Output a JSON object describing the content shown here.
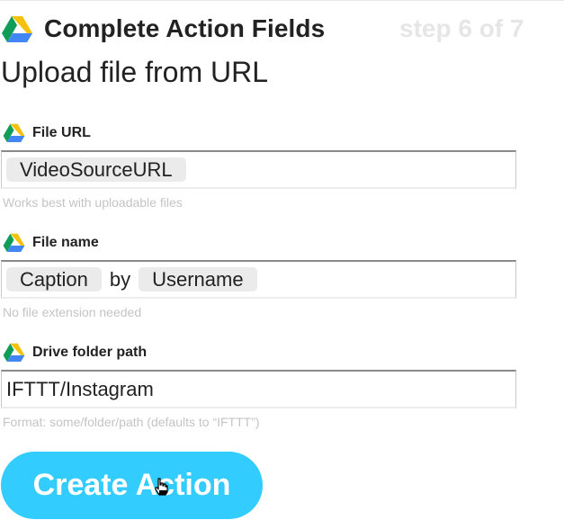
{
  "header": {
    "service_icon": "google-drive-icon",
    "title": "Complete Action Fields",
    "step": "step 6 of 7"
  },
  "action": {
    "title": "Upload file from URL"
  },
  "fields": [
    {
      "icon": "google-drive-icon",
      "label": "File URL",
      "tokens": [
        {
          "type": "ingredient",
          "text": "VideoSourceURL"
        }
      ],
      "help": "Works best with uploadable files"
    },
    {
      "icon": "google-drive-icon",
      "label": "File name",
      "tokens": [
        {
          "type": "ingredient",
          "text": "Caption"
        },
        {
          "type": "text",
          "text": "by"
        },
        {
          "type": "ingredient",
          "text": "Username"
        }
      ],
      "help": "No file extension needed"
    },
    {
      "icon": "google-drive-icon",
      "label": "Drive folder path",
      "tokens": [
        {
          "type": "text",
          "text": "IFTTT/Instagram"
        }
      ],
      "help": "Format: some/folder/path (defaults to “IFTTT”)"
    }
  ],
  "create_button": {
    "label": "Create Action",
    "color": "#33ccff"
  },
  "colors": {
    "drive_green": "#0f9d58",
    "drive_yellow": "#f4c20d",
    "drive_blue": "#4285f4",
    "step_text": "#e6e6e6",
    "help_text": "#c4c4c4"
  }
}
